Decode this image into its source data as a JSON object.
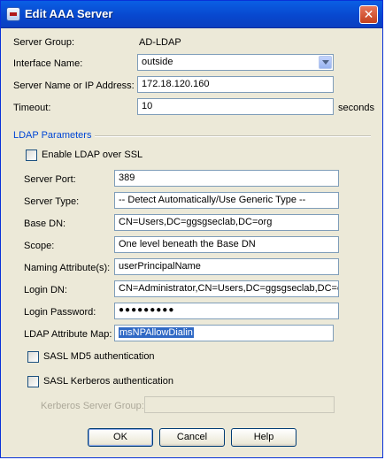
{
  "window": {
    "title": "Edit AAA Server",
    "close_glyph": "✕"
  },
  "server_group": {
    "label": "Server Group:",
    "value": "AD-LDAP"
  },
  "interface_name": {
    "label": "Interface Name:",
    "value": "outside"
  },
  "server_name": {
    "label": "Server Name or IP Address:",
    "value": "172.18.120.160"
  },
  "timeout": {
    "label": "Timeout:",
    "value": "10",
    "unit": "seconds"
  },
  "ldap": {
    "section_title": "LDAP Parameters",
    "enable_ssl": {
      "label": "Enable LDAP over SSL",
      "checked": false
    },
    "server_port": {
      "label": "Server Port:",
      "value": "389"
    },
    "server_type": {
      "label": "Server Type:",
      "value": "-- Detect Automatically/Use Generic Type --"
    },
    "base_dn": {
      "label": "Base DN:",
      "value": "CN=Users,DC=ggsgseclab,DC=org"
    },
    "scope": {
      "label": "Scope:",
      "value": "One level beneath the Base DN"
    },
    "naming_attribute": {
      "label": "Naming Attribute(s):",
      "value": "userPrincipalName"
    },
    "login_dn": {
      "label": "Login DN:",
      "value": "CN=Administrator,CN=Users,DC=ggsgseclab,DC=org"
    },
    "login_password": {
      "label": "Login Password:",
      "value": "●●●●●●●●●"
    },
    "attribute_map": {
      "label": "LDAP Attribute Map:",
      "value": "msNPAllowDialin"
    },
    "sasl_md5": {
      "label": "SASL MD5 authentication",
      "checked": false
    },
    "sasl_kerberos": {
      "label": "SASL Kerberos authentication",
      "checked": false
    },
    "kerberos_group": {
      "label": "Kerberos Server Group:",
      "value": ""
    }
  },
  "buttons": {
    "ok": "OK",
    "cancel": "Cancel",
    "help": "Help"
  }
}
